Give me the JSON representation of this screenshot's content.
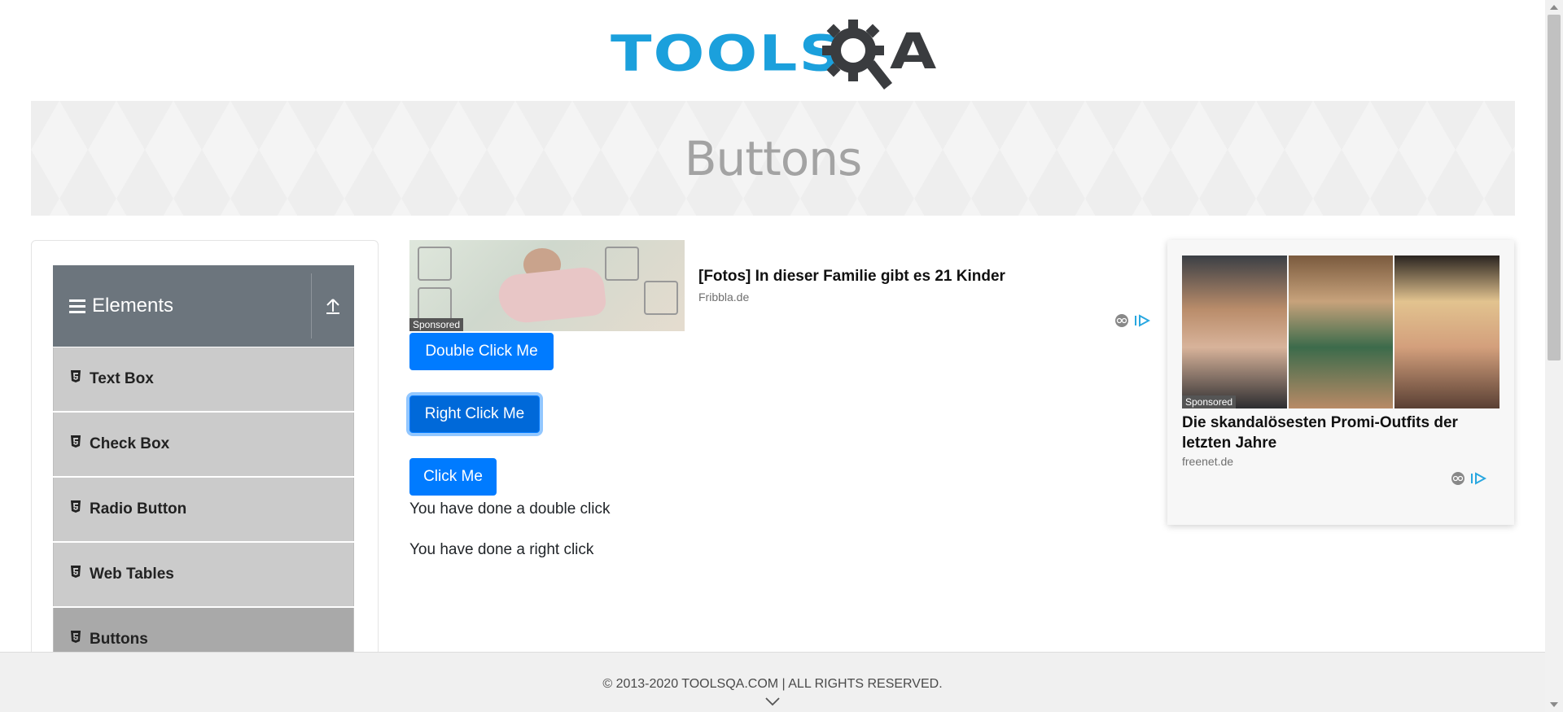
{
  "logo": {
    "text_main": "TOOLS",
    "text_end": "A",
    "colors": {
      "primary": "#1ba0dc",
      "dark": "#3a3c3f"
    }
  },
  "banner": {
    "title": "Buttons"
  },
  "sidebar": {
    "group_title": "Elements",
    "items": [
      {
        "label": "Text Box",
        "active": false
      },
      {
        "label": "Check Box",
        "active": false
      },
      {
        "label": "Radio Button",
        "active": false
      },
      {
        "label": "Web Tables",
        "active": false
      },
      {
        "label": "Buttons",
        "active": true
      }
    ]
  },
  "ad_top": {
    "sponsored": "Sponsored",
    "headline": "[Fotos] In dieser Familie gibt es 21 Kinder",
    "source": "Fribbla.de"
  },
  "buttons": {
    "double_click": "Double Click Me",
    "right_click": "Right Click Me",
    "click": "Click Me"
  },
  "messages": {
    "double_click": "You have done a double click",
    "right_click": "You have done a right click"
  },
  "ad_right": {
    "sponsored": "Sponsored",
    "headline": "Die skandalösesten Promi-Outfits der letzten Jahre",
    "source": "freenet.de"
  },
  "footer": {
    "copyright": "© 2013-2020 TOOLSQA.COM | ALL RIGHTS RESERVED."
  },
  "colors": {
    "primary_button": "#007bff",
    "sidebar_header": "#6c757d",
    "menu_item": "#cbcbcb",
    "menu_item_active": "#a9a9a9"
  }
}
